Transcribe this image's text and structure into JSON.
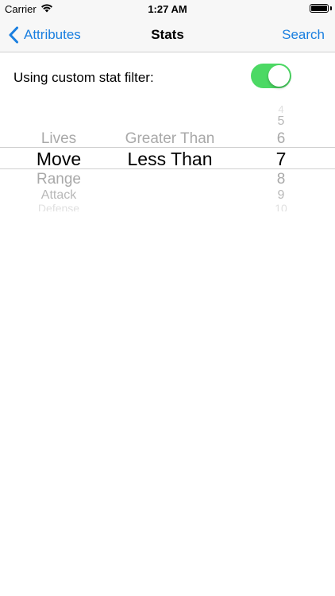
{
  "status_bar": {
    "carrier": "Carrier",
    "time": "1:27 AM"
  },
  "nav": {
    "back_label": "Attributes",
    "title": "Stats",
    "right_label": "Search"
  },
  "filter": {
    "label": "Using custom stat filter:",
    "enabled": true,
    "toggle_color": "#4cd964"
  },
  "picker": {
    "stat_column": {
      "above": [
        "Lives"
      ],
      "selected": "Move",
      "below": [
        "Range",
        "Attack",
        "Defense"
      ]
    },
    "comparison_column": {
      "above": [
        "Greater Than"
      ],
      "selected": "Less Than",
      "below": []
    },
    "value_column": {
      "above": [
        "4",
        "5",
        "6"
      ],
      "selected": "7",
      "below": [
        "8",
        "9",
        "10"
      ]
    }
  },
  "accent_color": "#1a7fe0"
}
